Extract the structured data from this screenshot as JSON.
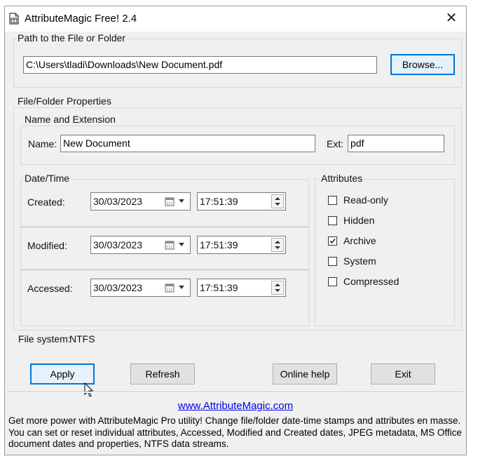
{
  "window": {
    "title": "AttributeMagic Free! 2.4",
    "close_glyph": "✕"
  },
  "path_group": {
    "label": "Path to the File or Folder",
    "path_value": "C:\\Users\\tladi\\Downloads\\New Document.pdf",
    "browse_label": "Browse..."
  },
  "properties_group": {
    "label": "File/Folder Properties",
    "name_ext": {
      "label": "Name and Extension",
      "name_label": "Name:",
      "name_value": "New Document",
      "ext_label": "Ext:",
      "ext_value": "pdf"
    },
    "datetime": {
      "label": "Date/Time",
      "rows": [
        {
          "label": "Created:",
          "date": "30/03/2023",
          "time": "17:51:39"
        },
        {
          "label": "Modified:",
          "date": "30/03/2023",
          "time": "17:51:39"
        },
        {
          "label": "Accessed:",
          "date": "30/03/2023",
          "time": "17:51:39"
        }
      ]
    },
    "attributes": {
      "label": "Attributes",
      "items": [
        {
          "label": "Read-only",
          "checked": false
        },
        {
          "label": "Hidden",
          "checked": false
        },
        {
          "label": "Archive",
          "checked": true
        },
        {
          "label": "System",
          "checked": false
        },
        {
          "label": "Compressed",
          "checked": false
        }
      ]
    },
    "file_system": {
      "label": "File system:",
      "value": "NTFS"
    }
  },
  "buttons": {
    "apply": "Apply",
    "refresh": "Refresh",
    "online_help": "Online help",
    "exit": "Exit"
  },
  "footer": {
    "link": "www.AttributeMagic.com",
    "promo_lines": [
      "Get more power with AttributeMagic Pro utility! Change file/folder date-time stamps and attributes en masse.",
      "You can set or reset individual attributes, Accessed, Modified and Created dates, JPEG metadata, MS Office",
      "document dates and properties, NTFS data streams."
    ]
  },
  "colors": {
    "accent": "#0078d7",
    "link": "#0000ee"
  }
}
